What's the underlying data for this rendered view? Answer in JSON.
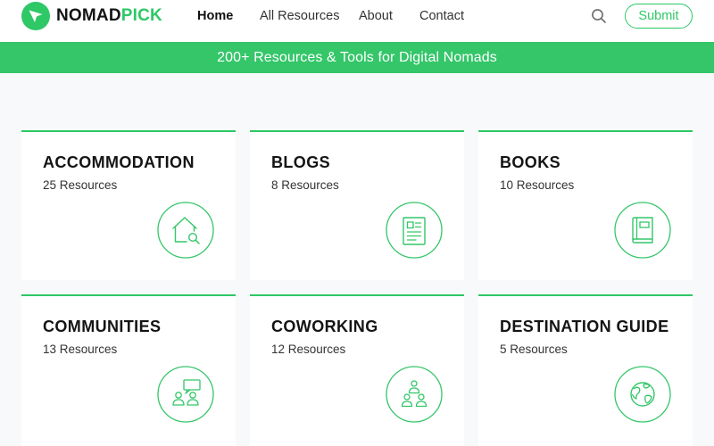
{
  "brand": {
    "name_part1": "NOMAD",
    "name_part2": "PICK",
    "accent_color": "#2ec866"
  },
  "nav": {
    "items": [
      {
        "label": "Home",
        "active": true
      },
      {
        "label": "All Resources",
        "active": false
      },
      {
        "label": "About",
        "active": false
      },
      {
        "label": "Contact",
        "active": false
      }
    ],
    "search_icon": "search-icon",
    "submit_label": "Submit"
  },
  "banner": {
    "text": "200+ Resources & Tools for Digital Nomads"
  },
  "categories": [
    {
      "title": "ACCOMMODATION",
      "count": "25 Resources",
      "icon": "house-search-icon"
    },
    {
      "title": "BLOGS",
      "count": "8 Resources",
      "icon": "article-icon"
    },
    {
      "title": "BOOKS",
      "count": "10 Resources",
      "icon": "book-icon"
    },
    {
      "title": "COMMUNITIES",
      "count": "13 Resources",
      "icon": "people-chat-icon"
    },
    {
      "title": "COWORKING",
      "count": "12 Resources",
      "icon": "team-icon"
    },
    {
      "title": "DESTINATION GUIDE",
      "count": "5 Resources",
      "icon": "globe-icon"
    }
  ]
}
